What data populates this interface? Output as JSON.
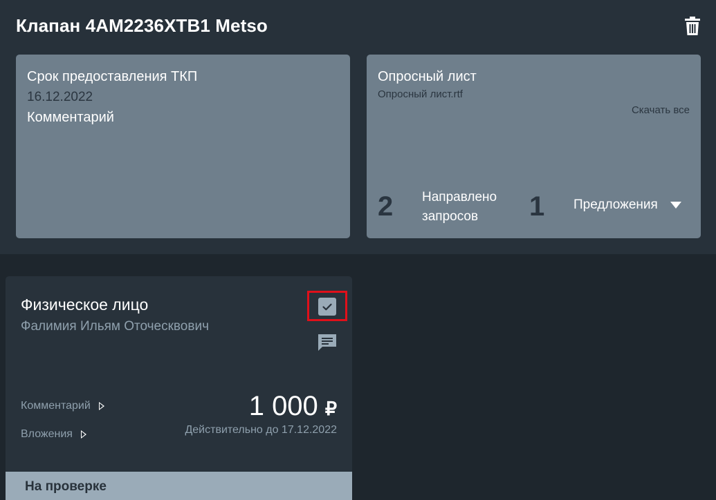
{
  "header": {
    "title": "Клапан 4AM2236XTB1 Metso",
    "delete_icon": "trash-icon"
  },
  "request_card": {
    "deadline_label": "Срок предоставления ТКП",
    "deadline_value": "16.12.2022",
    "comment_label": "Комментарий"
  },
  "questionnaire_card": {
    "title": "Опросный лист",
    "file_name": "Опросный лист.rtf",
    "download_all": "Скачать все",
    "sent_count": "2",
    "sent_label_line1": "Направлено",
    "sent_label_line2": "запросов",
    "offers_count": "1",
    "offers_label": "Предложения",
    "offers_icon": "caret-down-icon"
  },
  "offer": {
    "supplier_type": "Физическое лицо",
    "supplier_name": "Фалимия Ильям Оточесквович",
    "checked": true,
    "chat_icon": "chat-icon",
    "comment_link": "Комментарий",
    "attachments_link": "Вложения",
    "price": "1 000",
    "currency": "₽",
    "valid_until": "Действительно до 17.12.2022",
    "status": "На проверке"
  },
  "colors": {
    "page_bg": "#1e262d",
    "panel_bg": "#27313a",
    "card_bg": "#6f7f8c",
    "offer_bg": "#28323b",
    "status_bg": "#9aabb8",
    "highlight": "#e0101a"
  }
}
